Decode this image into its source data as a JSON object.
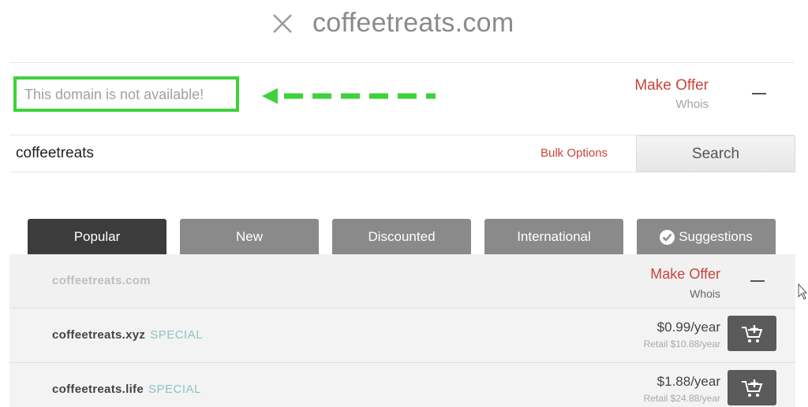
{
  "header": {
    "domain": "coffeetreats.com"
  },
  "availability": {
    "message": "This domain is not available!"
  },
  "offer": {
    "make_offer": "Make Offer",
    "whois": "Whois"
  },
  "search": {
    "value": "coffeetreats",
    "bulk_options": "Bulk Options",
    "button": "Search"
  },
  "tabs": [
    {
      "label": "Popular"
    },
    {
      "label": "New"
    },
    {
      "label": "Discounted"
    },
    {
      "label": "International"
    },
    {
      "label": "Suggestions"
    }
  ],
  "results": [
    {
      "domain": "coffeetreats.com",
      "make_offer": "Make Offer",
      "whois": "Whois"
    },
    {
      "domain": "coffeetreats.xyz",
      "tag": "SPECIAL",
      "price": "$0.99/year",
      "retail": "Retail $10.88/year"
    },
    {
      "domain": "coffeetreats.life",
      "tag": "SPECIAL",
      "price": "$1.88/year",
      "retail": "Retail $24.88/year"
    }
  ],
  "colors": {
    "accent_red": "#c8453a",
    "highlight_green": "#3ed23a",
    "tab_active": "#3c3c3c",
    "tab_inactive": "#8a8a8a"
  }
}
